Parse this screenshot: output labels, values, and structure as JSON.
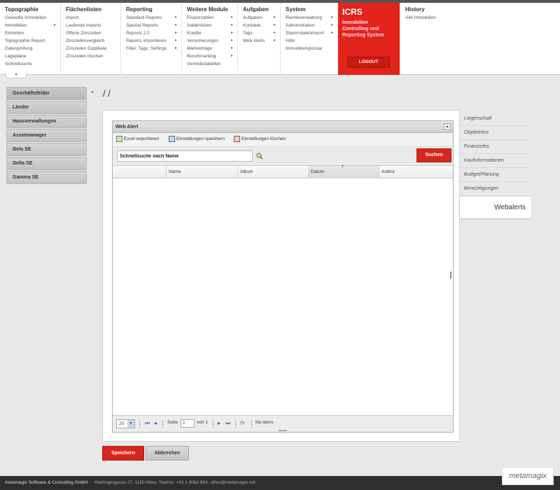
{
  "menu": {
    "columns": [
      {
        "title": "Topographie",
        "items": [
          {
            "label": "Gekaufte Immobilien",
            "arrow": false
          },
          {
            "label": "Immobilien",
            "arrow": true
          },
          {
            "label": "Einheiten",
            "arrow": false
          },
          {
            "label": "Topographie Report",
            "arrow": false
          },
          {
            "label": "Datenprüfung",
            "arrow": false
          },
          {
            "label": "Lagepläne",
            "arrow": false
          },
          {
            "label": "Schnellsuche",
            "arrow": false
          }
        ]
      },
      {
        "title": "Flächenlisten",
        "items": [
          {
            "label": "Import",
            "arrow": false
          },
          {
            "label": "Laufende Imports",
            "arrow": false
          },
          {
            "label": "Offene Zinszeilen",
            "arrow": false
          },
          {
            "label": "Zinszeilenvergleich",
            "arrow": false
          },
          {
            "label": "Zinszeilen Duplikate",
            "arrow": false
          },
          {
            "label": "Zinszeilen löschen",
            "arrow": false
          }
        ]
      },
      {
        "title": "Reporting",
        "items": [
          {
            "label": "Standard Reports",
            "arrow": true
          },
          {
            "label": "Spezial Reports",
            "arrow": true
          },
          {
            "label": "Reports 2.0",
            "arrow": true
          },
          {
            "label": "Reports importieren",
            "arrow": true
          },
          {
            "label": "Filter, Tags, Settings",
            "arrow": true
          }
        ]
      },
      {
        "title": "Weitere Module",
        "items": [
          {
            "label": "Finanzzahlen",
            "arrow": true
          },
          {
            "label": "Saldenlisten",
            "arrow": true
          },
          {
            "label": "Kredite",
            "arrow": true
          },
          {
            "label": "Versicherungen",
            "arrow": true
          },
          {
            "label": "Mietverträge",
            "arrow": true
          },
          {
            "label": "Benchmarking",
            "arrow": true
          },
          {
            "label": "Vertriebstabellen",
            "arrow": false
          }
        ]
      },
      {
        "title": "Aufgaben",
        "items": [
          {
            "label": "Aufgaben",
            "arrow": true
          },
          {
            "label": "Kontakte",
            "arrow": true
          },
          {
            "label": "Tags",
            "arrow": true
          },
          {
            "label": "Web Alerts",
            "arrow": true
          }
        ]
      },
      {
        "title": "System",
        "items": [
          {
            "label": "Rechteverwaltung",
            "arrow": true
          },
          {
            "label": "Administration",
            "arrow": true
          },
          {
            "label": "Stammdatenimport",
            "arrow": true
          },
          {
            "label": "Hilfe",
            "arrow": false
          },
          {
            "label": "Immobilienglossar",
            "arrow": false
          }
        ]
      }
    ],
    "icrs": {
      "title": "ICRS",
      "subtitle": "Immobilien Controlling und Reporting System",
      "logout_label": "LOGOUT"
    },
    "history": {
      "title": "History",
      "item": "Alle Immobilien"
    },
    "toggle_icon": "chevron-down-icon"
  },
  "left_nav": {
    "items": [
      "Geschäftsfelder",
      "Länder",
      "Hausverwaltungen",
      "Assetmanager",
      "Beta SE",
      "Delta SE",
      "Gamma SE"
    ]
  },
  "breadcrumb": "/ /",
  "grid": {
    "title": "Web Alert",
    "toolbar": {
      "export_label": "Excel exportieren",
      "save_settings_label": "Einstellungen speichern",
      "delete_settings_label": "Einstellungen löschen"
    },
    "search": {
      "value": "Schnellsuche nach Name",
      "button_label": "Suchen"
    },
    "columns": [
      "Name",
      "Album",
      "Datum",
      "Author"
    ],
    "sorted_column": "Datum",
    "pager": {
      "page_size": "25",
      "page_label": "Seite",
      "current_page": "1",
      "of_label": "von 1",
      "status": "No items"
    }
  },
  "right_tabs": {
    "items": [
      "Liegenschaft",
      "Objektinfos",
      "Finanzinfos",
      "Kaufinformationen",
      "Budget/Planung",
      "Berechtigungen"
    ],
    "active": "Webalerts"
  },
  "actions": {
    "save_label": "Speichern",
    "cancel_label": "Abbrechen"
  },
  "footer": {
    "company": "metamagix Software & Consulting GmbH",
    "address": "Hießingergasse 27, 1150 Wien, Telefon: +43 1 9062 894, office@metamagix.net"
  },
  "logo_text": "metamagix",
  "colors": {
    "accent_red": "#d7261e",
    "footer_bg": "#2f2f2f",
    "nav_bg": "#c8c8c8"
  }
}
